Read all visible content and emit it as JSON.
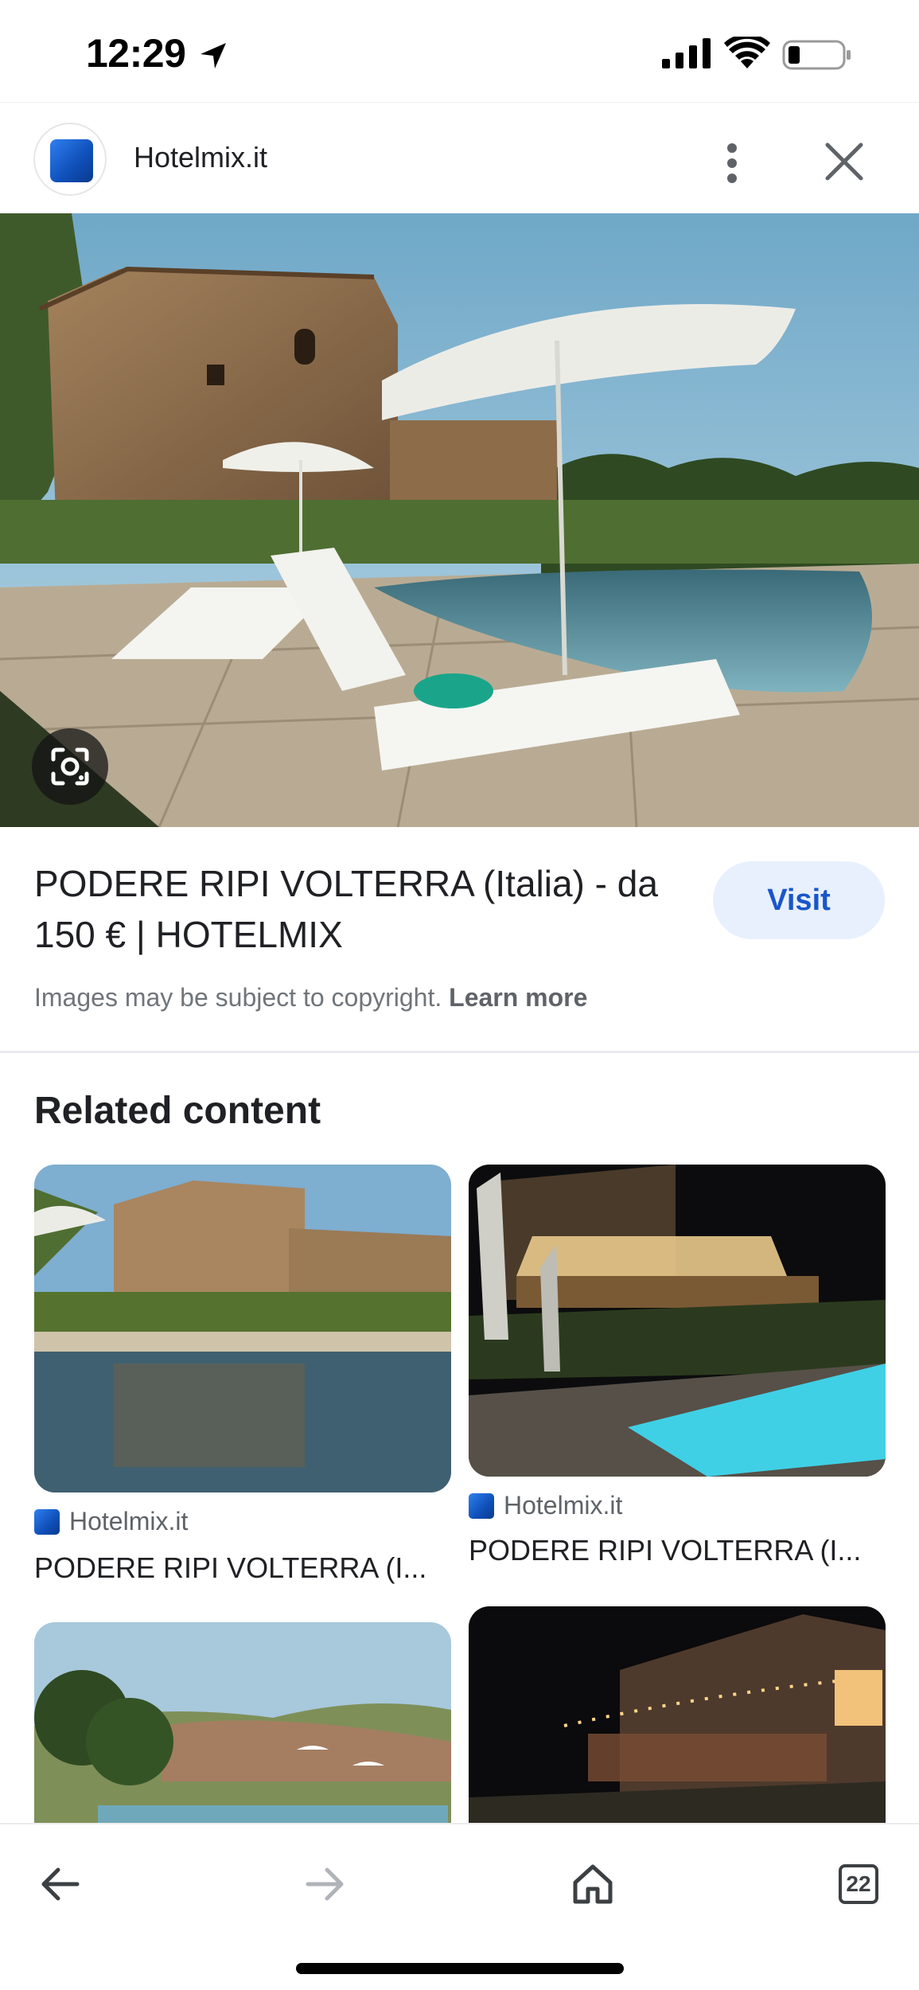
{
  "status_bar": {
    "time": "12:29",
    "icons": [
      "location-arrow-icon",
      "cellular-signal-icon",
      "wifi-icon",
      "battery-icon"
    ]
  },
  "header": {
    "site_name": "Hotelmix.it",
    "icons": [
      "site-favicon",
      "more-vertical-icon",
      "close-icon"
    ]
  },
  "hero": {
    "lens_icon": "google-lens-icon"
  },
  "result": {
    "title": "PODERE RIPI VOLTERRA (Italia) - da 150 € | HOTELMIX",
    "visit_label": "Visit",
    "copyright_text": "Images may be subject to copyright.",
    "learn_more": "Learn more"
  },
  "related": {
    "heading": "Related content",
    "cards": [
      {
        "source": "Hotelmix.it",
        "title": "PODERE RIPI VOLTERRA (I..."
      },
      {
        "source": "Hotelmix.it",
        "title": "PODERE RIPI VOLTERRA (I..."
      }
    ]
  },
  "toolbar": {
    "tab_count": "22",
    "icons": [
      "back-arrow-icon",
      "forward-arrow-icon",
      "home-icon",
      "tabs-icon"
    ]
  },
  "colors": {
    "accent": "#1a56c9",
    "visit_bg": "#e8f0fe",
    "text_primary": "#202124",
    "text_secondary": "#70757a"
  }
}
